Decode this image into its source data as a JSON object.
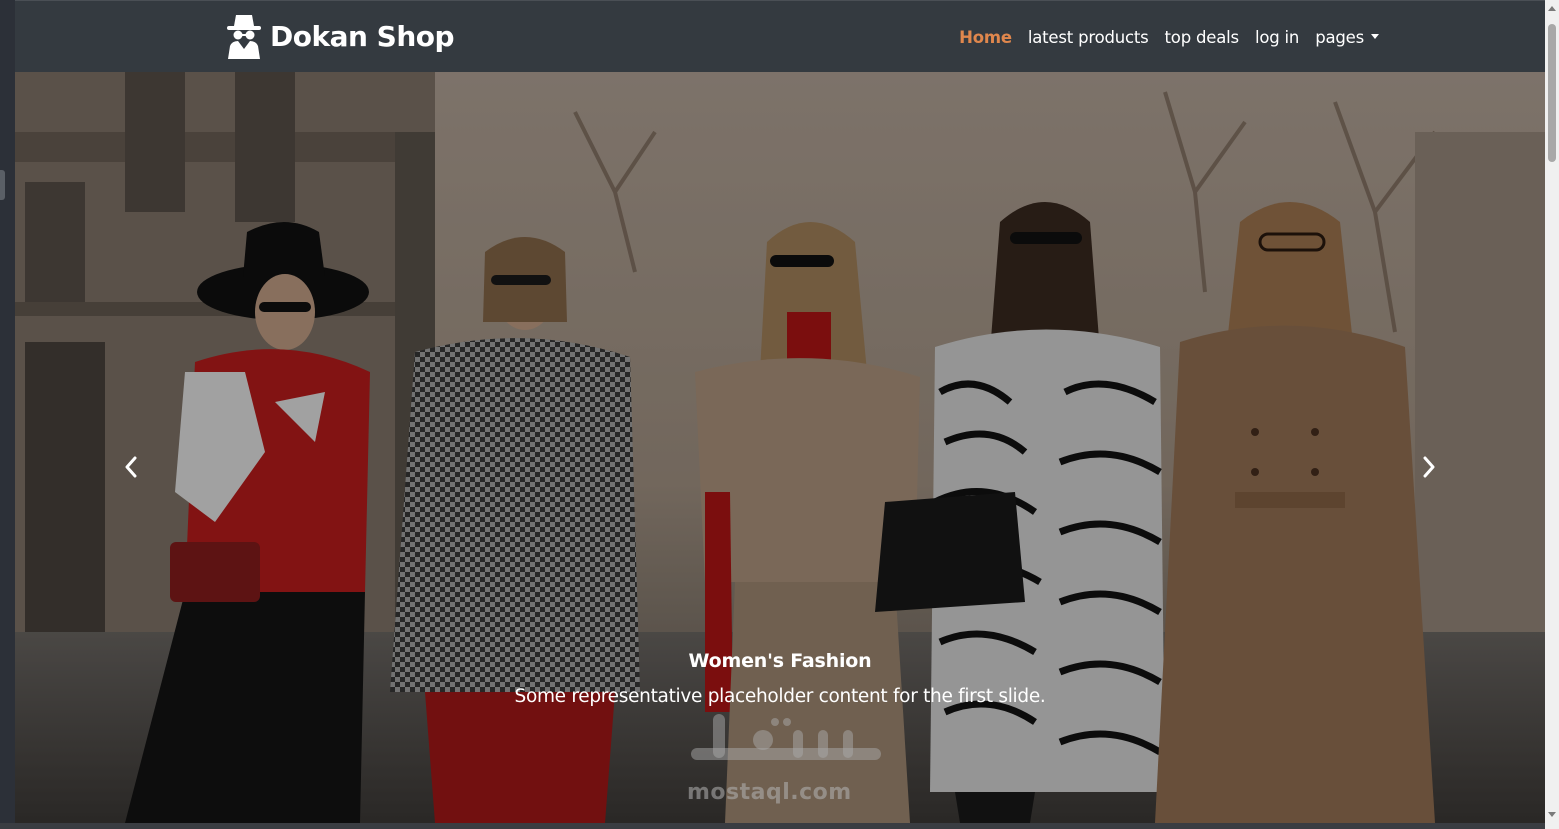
{
  "brand": {
    "name": "Dokan Shop",
    "icon": "incognito-spy-icon"
  },
  "nav": {
    "items": [
      {
        "label": "Home",
        "active": true
      },
      {
        "label": "latest products",
        "active": false
      },
      {
        "label": "top deals",
        "active": false
      },
      {
        "label": "log in",
        "active": false
      },
      {
        "label": "pages",
        "active": false,
        "dropdown": true
      }
    ]
  },
  "carousel": {
    "slide_title": "Women's Fashion",
    "slide_text": "Some representative placeholder content for the first slide.",
    "prev_icon": "chevron-left-icon",
    "next_icon": "chevron-right-icon"
  },
  "watermark": {
    "arabic": "مستقل",
    "latin": "mostaql.com"
  },
  "colors": {
    "navbar_bg": "#343a40",
    "nav_active": "#e0874d",
    "nav_text": "#ffffff"
  }
}
